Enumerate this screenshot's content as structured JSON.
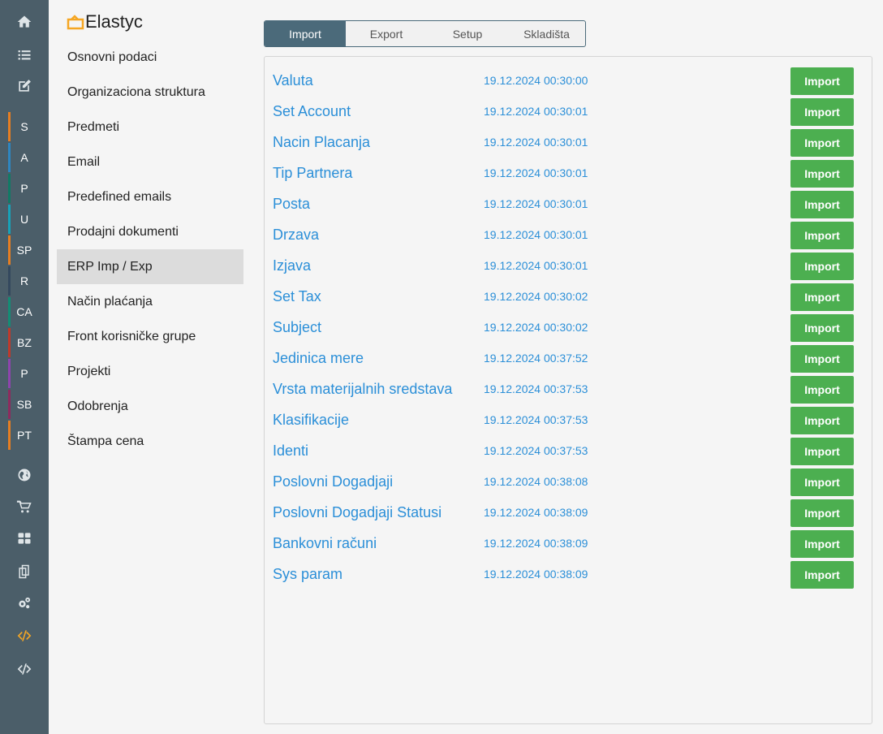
{
  "app": {
    "name": "Elastyc",
    "brand_color": "#f5a623"
  },
  "rail": {
    "top_icons": [
      "home-icon",
      "list-icon",
      "edit-icon"
    ],
    "modules": [
      {
        "label": "S",
        "color": "#e67e22"
      },
      {
        "label": "A",
        "color": "#2e86c1"
      },
      {
        "label": "P",
        "color": "#117a65"
      },
      {
        "label": "U",
        "color": "#17a2b8"
      },
      {
        "label": "SP",
        "color": "#e67e22"
      },
      {
        "label": "R",
        "color": "#34495e"
      },
      {
        "label": "CA",
        "color": "#138d75"
      },
      {
        "label": "BZ",
        "color": "#c0392b"
      },
      {
        "label": "P",
        "color": "#8e44ad"
      },
      {
        "label": "SB",
        "color": "#8e2b5e"
      },
      {
        "label": "PT",
        "color": "#e67e22"
      }
    ],
    "bottom_icons": [
      "globe-icon",
      "cart-icon",
      "dashboard-icon",
      "documents-icon",
      "settings-icon",
      "code-icon-active",
      "code-icon"
    ]
  },
  "sidebar": {
    "items": [
      {
        "label": "Osnovni podaci"
      },
      {
        "label": "Organizaciona struktura"
      },
      {
        "label": "Predmeti"
      },
      {
        "label": "Email"
      },
      {
        "label": "Predefined emails"
      },
      {
        "label": "Prodajni dokumenti"
      },
      {
        "label": "ERP Imp / Exp",
        "active": true
      },
      {
        "label": "Način plaćanja"
      },
      {
        "label": "Front korisničke grupe"
      },
      {
        "label": "Projekti"
      },
      {
        "label": "Odobrenja"
      },
      {
        "label": "Štampa cena"
      }
    ]
  },
  "tabs": [
    {
      "label": "Import",
      "active": true
    },
    {
      "label": "Export"
    },
    {
      "label": "Setup"
    },
    {
      "label": "Skladišta"
    }
  ],
  "import_button_label": "Import",
  "rows": [
    {
      "name": "Valuta",
      "date": "19.12.2024 00:30:00"
    },
    {
      "name": "Set Account",
      "date": "19.12.2024 00:30:01"
    },
    {
      "name": "Nacin Placanja",
      "date": "19.12.2024 00:30:01"
    },
    {
      "name": "Tip Partnera",
      "date": "19.12.2024 00:30:01"
    },
    {
      "name": "Posta",
      "date": "19.12.2024 00:30:01"
    },
    {
      "name": "Drzava",
      "date": "19.12.2024 00:30:01"
    },
    {
      "name": "Izjava",
      "date": "19.12.2024 00:30:01"
    },
    {
      "name": "Set Tax",
      "date": "19.12.2024 00:30:02"
    },
    {
      "name": "Subject",
      "date": "19.12.2024 00:30:02"
    },
    {
      "name": "Jedinica mere",
      "date": "19.12.2024 00:37:52"
    },
    {
      "name": "Vrsta materijalnih sredstava",
      "date": "19.12.2024 00:37:53"
    },
    {
      "name": "Klasifikacije",
      "date": "19.12.2024 00:37:53"
    },
    {
      "name": "Identi",
      "date": "19.12.2024 00:37:53"
    },
    {
      "name": "Poslovni Dogadjaji",
      "date": "19.12.2024 00:38:08"
    },
    {
      "name": "Poslovni Dogadjaji Statusi",
      "date": "19.12.2024 00:38:09"
    },
    {
      "name": "Bankovni računi",
      "date": "19.12.2024 00:38:09"
    },
    {
      "name": "Sys param",
      "date": "19.12.2024 00:38:09"
    }
  ]
}
